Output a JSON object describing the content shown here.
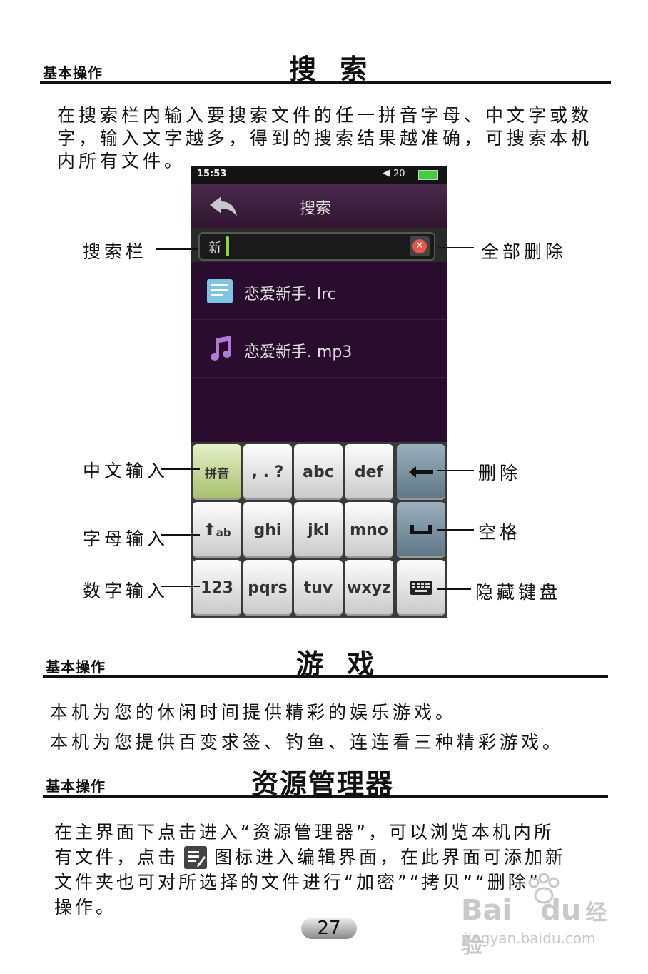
{
  "section1": {
    "category": "基本操作",
    "title": "搜 索",
    "intro_lines": [
      "在搜索栏内输入要搜索文件的任一拼音字母、中文字或数",
      "字，输入文字越多，得到的搜索结果越准确，可搜索本机",
      "内所有文件。"
    ]
  },
  "phone": {
    "status_time": "15:53",
    "status_volume": "20",
    "screen_title": "搜索",
    "search_text": "新",
    "results": [
      "恋爱新手. lrc",
      "恋爱新手. mp3"
    ],
    "keys": [
      [
        "拼音",
        ", . ?",
        "abc",
        "def"
      ],
      [
        "ab",
        "ghi",
        "jkl",
        "mno"
      ],
      [
        "123",
        "pqrs",
        "tuv",
        "wxyz"
      ]
    ]
  },
  "callouts": {
    "search_bar": "搜索栏",
    "delete_all": "全部删除",
    "chinese_input": "中文输入",
    "delete": "删除",
    "letter_input": "字母输入",
    "space": "空格",
    "number_input": "数字输入",
    "hide_keyboard": "隐藏键盘"
  },
  "section2": {
    "category": "基本操作",
    "title": "游 戏",
    "lines": [
      "本机为您的休闲时间提供精彩的娱乐游戏。",
      "本机为您提供百变求签、钓鱼、连连看三种精彩游戏。"
    ]
  },
  "section3": {
    "category": "基本操作",
    "title": "资源管理器",
    "line1": "在主界面下点击进入“资源管理器”，可以浏览本机内所",
    "line2a": "有文件，点击",
    "line2b": "图标进入编辑界面，在此界面可添加新",
    "line3": "文件夹也可对所选择的文件进行“加密”“拷贝”“删除”",
    "line4": "操作。"
  },
  "page_number": "27",
  "watermark": {
    "brand": "Bai",
    "brand2": "du",
    "suffix": "经验",
    "url": "jingyan.baidu.com"
  },
  "colors": {
    "phone_bg": "#2a0d2e",
    "pinyin_key": "#c4d68e",
    "dark_key": "#6f8796"
  }
}
